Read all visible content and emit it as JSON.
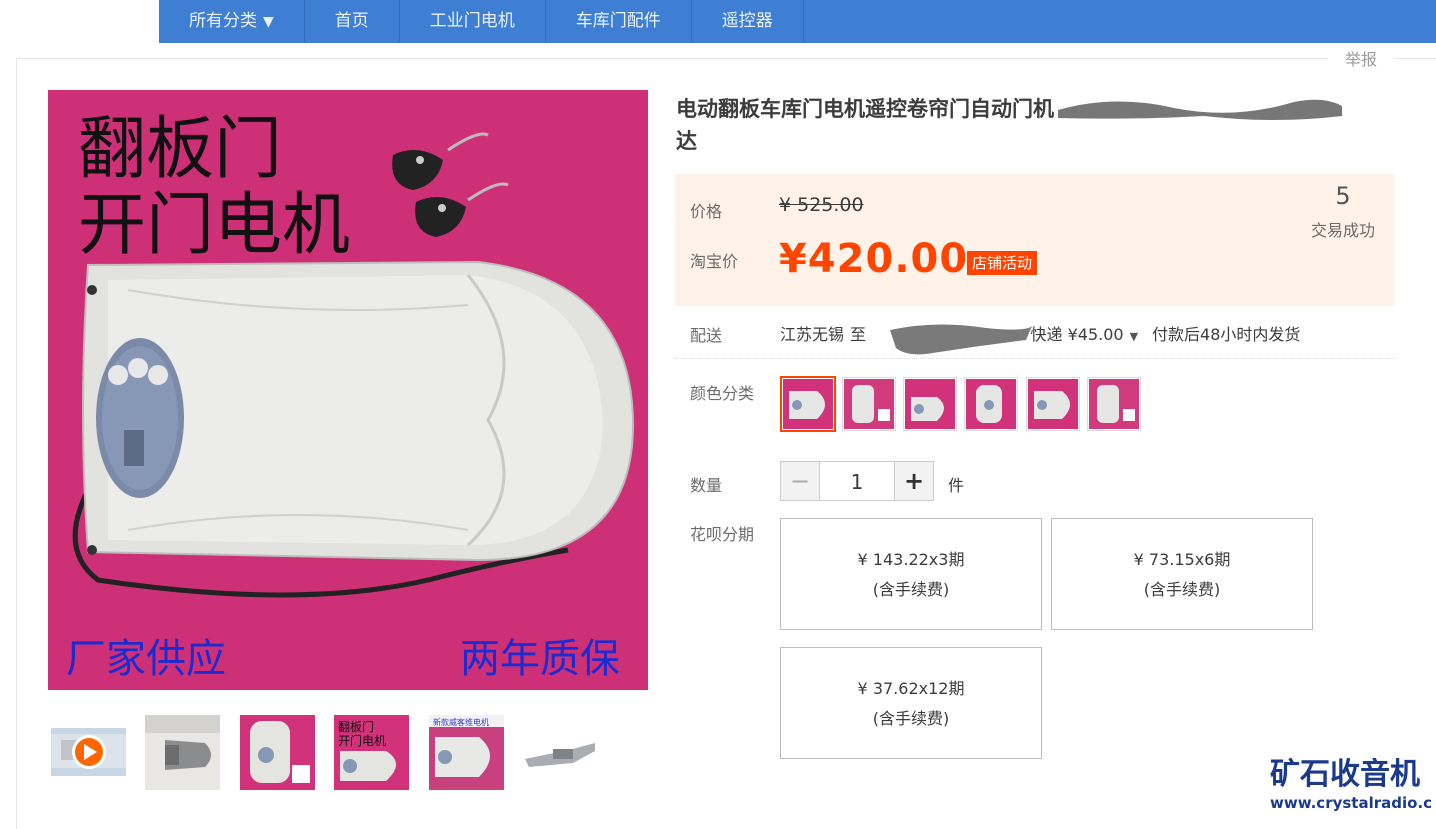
{
  "nav": {
    "items": [
      "所有分类",
      "首页",
      "工业门电机",
      "车库门配件",
      "遥控器"
    ],
    "caret": "▼"
  },
  "report_label": "举报",
  "product": {
    "title": "电动翻板车库门电机遥控卷帘门自动门机",
    "title_end": "达",
    "image_text": {
      "line1": "翻板门",
      "line2": "开门电机",
      "bottom_left": "厂家供应",
      "bottom_right": "两年质保"
    },
    "thumb_label": "新款威客维电机"
  },
  "price": {
    "label": "价格",
    "original": "¥ 525.00",
    "promo_label": "淘宝价",
    "current": "¥420.00",
    "promo_badge": "店铺活动",
    "sold_count": "5",
    "sold_label": "交易成功"
  },
  "shipping": {
    "label": "配送",
    "from": "江苏无锡",
    "to_word": "至",
    "method": "快递 ¥45.00",
    "dispatch": "付款后48小时内发货"
  },
  "color": {
    "label": "颜色分类",
    "selected_index": 0
  },
  "quantity": {
    "label": "数量",
    "value": "1",
    "minus": "−",
    "plus": "+",
    "unit": "件"
  },
  "installments": {
    "label": "花呗分期",
    "options": [
      {
        "amount": "¥ 143.22x3期",
        "note": "(含手续费)"
      },
      {
        "amount": "¥ 73.15x6期",
        "note": "(含手续费)"
      },
      {
        "amount": "¥ 37.62x12期",
        "note": "(含手续费)"
      }
    ]
  },
  "watermark": {
    "text": "矿石收音机",
    "url": "www.crystalradio.cn"
  },
  "colors": {
    "nav_bg": "#3e7fd4",
    "accent": "#ff4400",
    "price_bg": "#fff2e8",
    "image_bg": "#d2327a"
  }
}
